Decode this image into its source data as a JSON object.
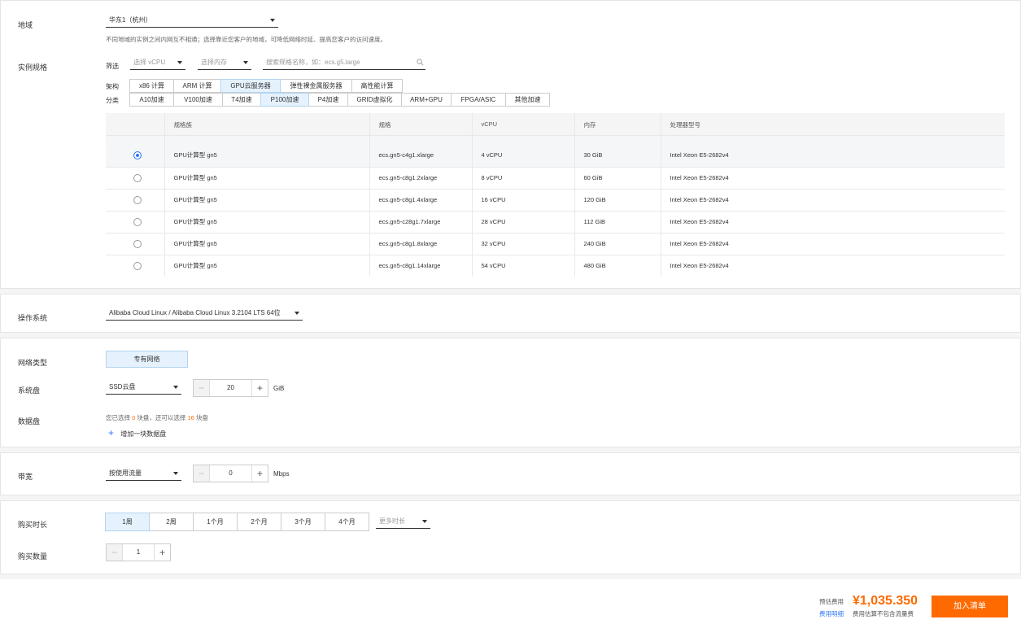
{
  "region": {
    "label": "地域",
    "selected": "华东1（杭州）",
    "hint": "不同地域的实例之间内网互不相通；选择靠近您客户的地域，可降低网络时延、提高您客户的访问速度。"
  },
  "instance_type": {
    "label": "实例规格",
    "filter_label": "筛选",
    "vcpu_placeholder": "选择 vCPU",
    "memory_placeholder": "选择内存",
    "search_placeholder": "搜索规格名称，如：ecs.g5.large",
    "arch_label": "架构",
    "arch_options": [
      "x86 计算",
      "ARM 计算",
      "GPU云服务器",
      "弹性裸金属服务器",
      "高性能计算"
    ],
    "arch_selected": 2,
    "category_label": "分类",
    "category_options": [
      "A10加速",
      "V100加速",
      "T4加速",
      "P100加速",
      "P4加速",
      "GRID虚拟化",
      "ARM+GPU",
      "FPGA/ASIC",
      "其他加速"
    ],
    "category_selected": 3,
    "table": {
      "headers": [
        "",
        "规格族",
        "规格",
        "vCPU",
        "内存",
        "处理器型号"
      ],
      "rows": [
        {
          "family": "GPU计算型 gn5",
          "spec": "ecs.gn5-c4g1.xlarge",
          "vcpu": "4 vCPU",
          "memory": "30 GiB",
          "cpu": "Intel Xeon E5-2682v4",
          "selected": true
        },
        {
          "family": "GPU计算型 gn5",
          "spec": "ecs.gn5-c8g1.2xlarge",
          "vcpu": "8 vCPU",
          "memory": "60 GiB",
          "cpu": "Intel Xeon E5-2682v4",
          "selected": false
        },
        {
          "family": "GPU计算型 gn5",
          "spec": "ecs.gn5-c8g1.4xlarge",
          "vcpu": "16 vCPU",
          "memory": "120 GiB",
          "cpu": "Intel Xeon E5-2682v4",
          "selected": false
        },
        {
          "family": "GPU计算型 gn5",
          "spec": "ecs.gn5-c28g1.7xlarge",
          "vcpu": "28 vCPU",
          "memory": "112 GiB",
          "cpu": "Intel Xeon E5-2682v4",
          "selected": false
        },
        {
          "family": "GPU计算型 gn5",
          "spec": "ecs.gn5-c8g1.8xlarge",
          "vcpu": "32 vCPU",
          "memory": "240 GiB",
          "cpu": "Intel Xeon E5-2682v4",
          "selected": false
        },
        {
          "family": "GPU计算型 gn5",
          "spec": "ecs.gn5-c8g1.14xlarge",
          "vcpu": "54 vCPU",
          "memory": "480 GiB",
          "cpu": "Intel Xeon E5-2682v4",
          "selected": false
        }
      ]
    }
  },
  "os": {
    "label": "操作系统",
    "selected": "Alibaba Cloud Linux / Alibaba Cloud Linux 3.2104 LTS 64位"
  },
  "network": {
    "label": "网络类型",
    "option": "专有网络"
  },
  "system_disk": {
    "label": "系统盘",
    "type": "SSD云盘",
    "size": "20",
    "unit": "GiB"
  },
  "data_disk": {
    "label": "数据盘",
    "hint_prefix": "您已选择",
    "selected_count": "0",
    "hint_mid": "块盘，还可以选择",
    "remaining_count": "16",
    "hint_suffix": "块盘",
    "add_label": "增加一块数据盘"
  },
  "bandwidth": {
    "label": "带宽",
    "type": "按使用流量",
    "value": "0",
    "unit": "Mbps"
  },
  "duration": {
    "label": "购买时长",
    "options": [
      "1周",
      "2周",
      "1个月",
      "2个月",
      "3个月",
      "4个月"
    ],
    "selected": 0,
    "more_placeholder": "更多时长"
  },
  "quantity": {
    "label": "购买数量",
    "value": "1"
  },
  "footer": {
    "estimate_label": "预估费用",
    "detail_link": "费用明细",
    "price": "¥1,035.350",
    "price_note": "费用估算不包含流量费",
    "add_button": "加入清单"
  },
  "colors": {
    "accent_blue": "#2d77f7",
    "orange": "#ff6a00",
    "selected_bg": "#e5f2fd"
  }
}
